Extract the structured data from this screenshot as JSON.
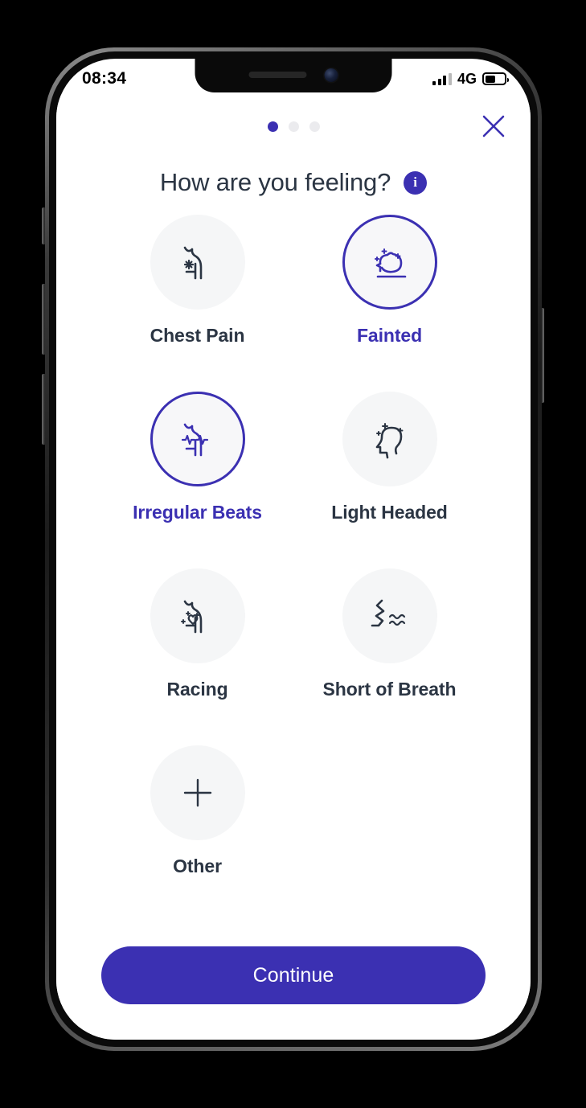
{
  "status_bar": {
    "time": "08:34",
    "network": "4G",
    "signal_bars_filled": 3,
    "signal_bars_total": 4,
    "battery_level_percent": 55
  },
  "header": {
    "pager": {
      "total": 3,
      "active_index": 0
    },
    "close_icon": "close-icon",
    "title": "How are you feeling?",
    "info_icon_label": "i"
  },
  "options": [
    {
      "label": "Chest Pain",
      "icon": "chest-pain-icon",
      "selected": false
    },
    {
      "label": "Fainted",
      "icon": "fainted-icon",
      "selected": true
    },
    {
      "label": "Irregular Beats",
      "icon": "irregular-beats-icon",
      "selected": true
    },
    {
      "label": "Light Headed",
      "icon": "light-headed-icon",
      "selected": false
    },
    {
      "label": "Racing",
      "icon": "racing-icon",
      "selected": false
    },
    {
      "label": "Short of Breath",
      "icon": "short-of-breath-icon",
      "selected": false
    },
    {
      "label": "Other",
      "icon": "plus-icon",
      "selected": false
    }
  ],
  "footer": {
    "continue_label": "Continue"
  },
  "colors": {
    "accent": "#3b30b2",
    "text_dark": "#2b3543",
    "circle_bg": "#f5f6f7",
    "dot_inactive": "#ebebee",
    "screen_bg": "#ffffff"
  }
}
